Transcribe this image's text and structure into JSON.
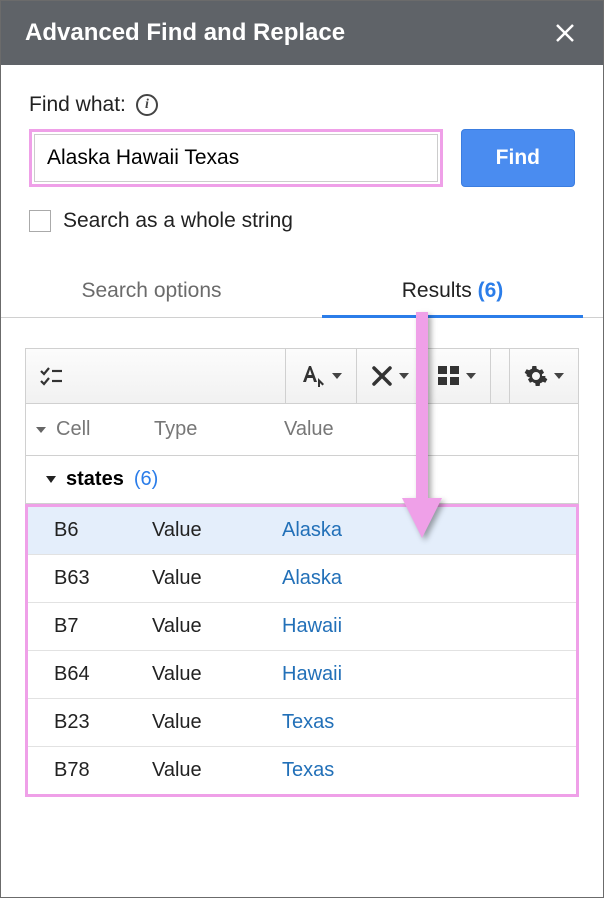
{
  "title": "Advanced Find and Replace",
  "find": {
    "label": "Find what:",
    "value": "Alaska Hawaii Texas",
    "button": "Find"
  },
  "checkbox": {
    "label": "Search as a whole string",
    "checked": false
  },
  "tabs": {
    "search_options": "Search options",
    "results": "Results",
    "results_count": "(6)"
  },
  "columns": {
    "cell": "Cell",
    "type": "Type",
    "value": "Value"
  },
  "group": {
    "name": "states",
    "count": "(6)"
  },
  "rows": [
    {
      "cell": "B6",
      "type": "Value",
      "value": "Alaska"
    },
    {
      "cell": "B63",
      "type": "Value",
      "value": "Alaska"
    },
    {
      "cell": "B7",
      "type": "Value",
      "value": "Hawaii"
    },
    {
      "cell": "B64",
      "type": "Value",
      "value": "Hawaii"
    },
    {
      "cell": "B23",
      "type": "Value",
      "value": "Texas"
    },
    {
      "cell": "B78",
      "type": "Value",
      "value": "Texas"
    }
  ],
  "colors": {
    "accent": "#2b7de9",
    "highlight": "#efa0e8",
    "button": "#4a8cf0"
  }
}
